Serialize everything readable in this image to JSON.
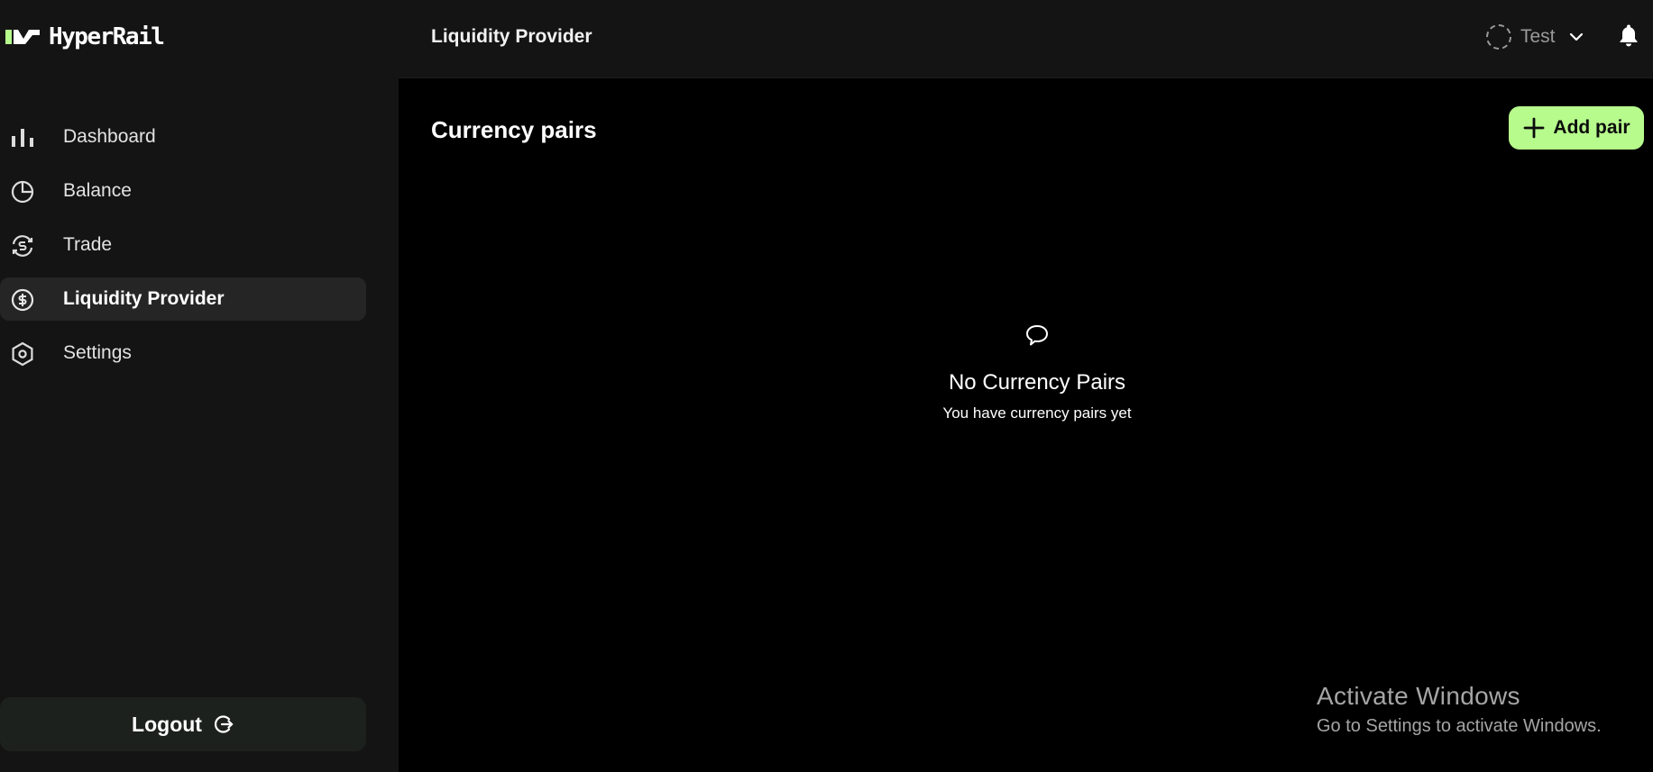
{
  "app": {
    "logo_text": "HyperRail",
    "brand_color": "#b6fb8c"
  },
  "sidebar": {
    "items": [
      {
        "label": "Dashboard",
        "icon": "bar-chart-icon",
        "active": false
      },
      {
        "label": "Balance",
        "icon": "pie-chart-icon",
        "active": false
      },
      {
        "label": "Trade",
        "icon": "exchange-dollar-icon",
        "active": false
      },
      {
        "label": "Liquidity Provider",
        "icon": "dollar-circle-icon",
        "active": true
      },
      {
        "label": "Settings",
        "icon": "hexagon-gear-icon",
        "active": false
      }
    ],
    "logout_label": "Logout"
  },
  "topbar": {
    "page_title": "Liquidity Provider",
    "user_name": "Test"
  },
  "main": {
    "section_title": "Currency pairs",
    "add_button_label": "Add pair",
    "empty_state": {
      "title": "No Currency Pairs",
      "subtitle": "You have currency pairs yet"
    }
  },
  "watermark": {
    "title": "Activate Windows",
    "subtitle": "Go to Settings to activate Windows."
  }
}
